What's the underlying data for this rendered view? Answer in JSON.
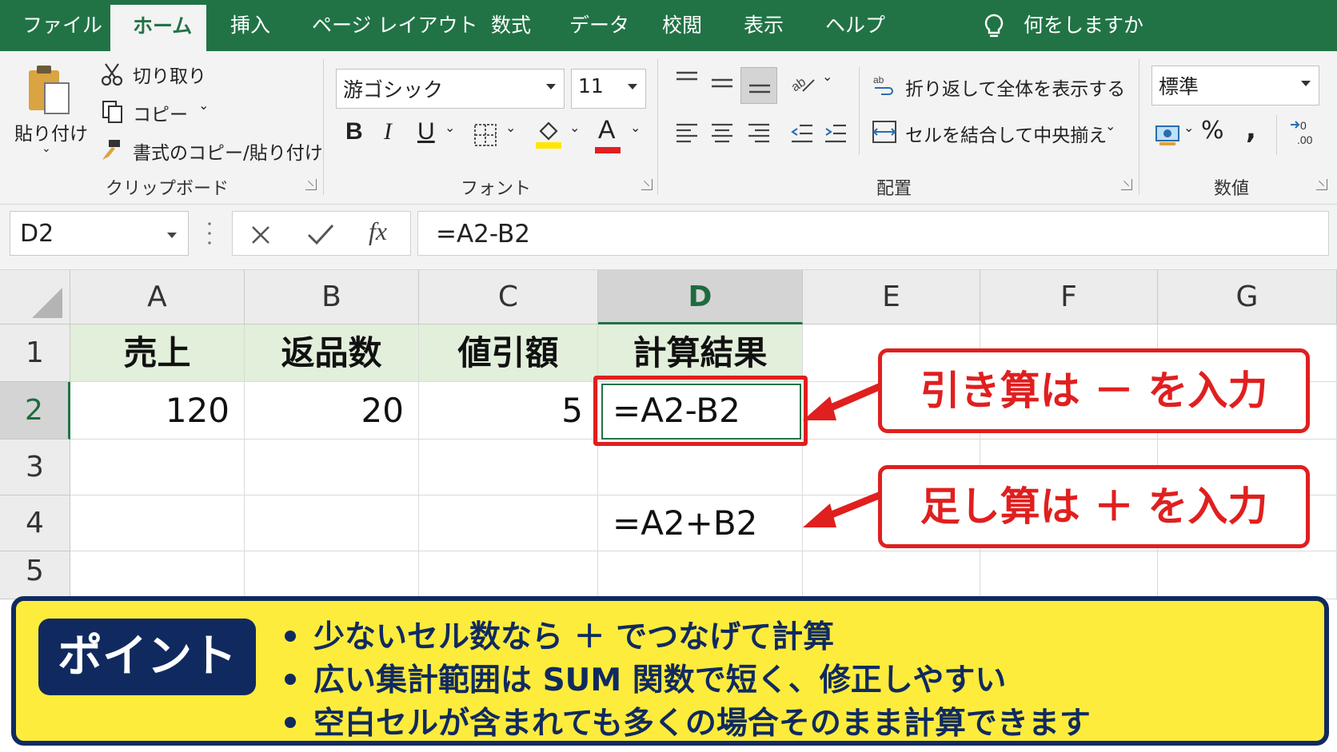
{
  "ribbon_tabs": [
    "ファイル",
    "ホーム",
    "挿入",
    "ページ レイアウト",
    "数式",
    "データ",
    "校閲",
    "表示",
    "ヘルプ"
  ],
  "tell_me": "何をしますか",
  "clipboard": {
    "paste": "貼り付け",
    "cut": "切り取り",
    "copy": "コピー",
    "format_painter": "書式のコピー/貼り付け",
    "group_label": "クリップボード"
  },
  "font": {
    "name": "游ゴシック",
    "size": "11",
    "bold": "B",
    "italic": "I",
    "underline": "U",
    "color_letter": "A",
    "group_label": "フォント"
  },
  "alignment": {
    "wrap_text": "折り返して全体を表示する",
    "merge_center": "セルを結合して中央揃え",
    "group_label": "配置"
  },
  "number": {
    "format": "標準",
    "percent": "%",
    "comma": ",",
    "group_label": "数値"
  },
  "formula_bar": {
    "name_box": "D2",
    "fx": "fx",
    "formula": "=A2-B2"
  },
  "grid": {
    "columns": [
      "A",
      "B",
      "C",
      "D",
      "E",
      "F",
      "G"
    ],
    "rows": [
      "1",
      "2",
      "3",
      "4",
      "5"
    ],
    "row1": [
      "売上",
      "返品数",
      "値引額",
      "計算結果"
    ],
    "row2": [
      "120",
      "20",
      "5",
      "=A2-B2"
    ],
    "row4_d": "=A2+B2"
  },
  "annotations": {
    "subtract": "引き算は － を入力",
    "add": "足し算は ＋ を入力"
  },
  "point": {
    "label": "ポイント",
    "bullets": [
      "少ないセル数なら ＋ でつなげて計算",
      "広い集計範囲は SUM 関数で短く、修正しやすい",
      "空白セルが含まれても多くの場合そのまま計算できます"
    ]
  },
  "colors": {
    "excel_green": "#217346",
    "header_fill": "#e2efda",
    "callout_red": "#e01f1f",
    "point_yellow": "#fdec3c",
    "point_navy": "#102a60"
  }
}
